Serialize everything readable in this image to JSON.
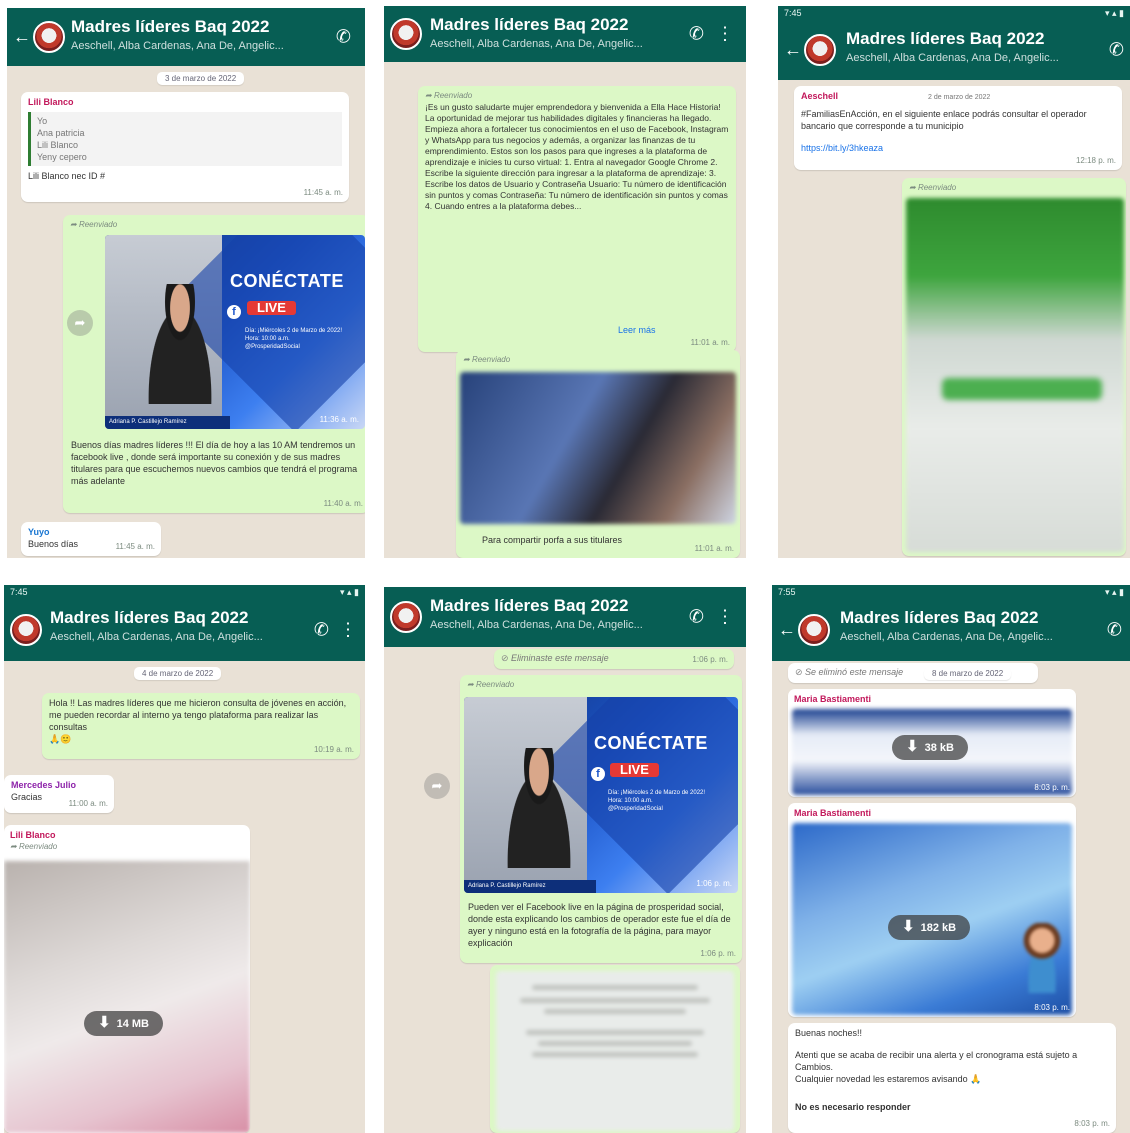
{
  "chat": {
    "title": "Madres líderes Baq 2022",
    "subtitle": "Aeschell, Alba Cardenas, Ana De, Angelic..."
  },
  "status": {
    "time": "7:45",
    "time2": "7:55"
  },
  "forwarded_label": "Reenviado",
  "p1": {
    "date": "3 de marzo de 2022",
    "reply_sender": "Lili Blanco",
    "reply_lines": [
      "Yo",
      "Ana patricia",
      "Lili Blanco",
      "Yeny cepero"
    ],
    "reply_text": "Lili Blanco nec ID #",
    "reply_time": "11:45 a. m.",
    "poster": {
      "headline": "CONÉCTATE",
      "live": "LIVE",
      "info_lines": [
        "Día: ¡Miércoles 2 de Marzo de 2022!",
        "Hora: 10:00 a.m."
      ],
      "handle": "@ProsperidadSocial",
      "caption": "Adriana P. Castillejo Ramírez",
      "time": "11:36 a. m."
    },
    "post_text": "Buenos días madres líderes !!! El día de hoy a las 10 AM tendremos un facebook live , donde será importante su conexión y de sus madres titulares para que escuchemos nuevos cambios que tendrá el programa más adelante",
    "post_time": "11:40 a. m.",
    "last_sender": "Yuyo",
    "last_text": "Buenos días",
    "last_time": "11:45 a. m."
  },
  "p2": {
    "msg_text": "¡Es un gusto saludarte mujer emprendedora y bienvenida a Ella Hace Historia! La oportunidad de mejorar tus habilidades digitales y financieras ha llegado. Empieza ahora a fortalecer tus conocimientos en el uso de Facebook, Instagram y WhatsApp para tus negocios y además, a organizar las finanzas de tu emprendimiento. Estos son los pasos para que ingreses a la plataforma de aprendizaje e inicies tu curso virtual: 1. Entra al navegador Google Chrome 2. Escribe la siguiente dirección para ingresar a la plataforma de aprendizaje: 3. Escribe los datos de Usuario y Contraseña Usuario: Tu número de identificación sin puntos y comas Contraseña: Tu número de identificación sin puntos y comas 4. Cuando entres a la plataforma debes...",
    "read_more": "Leer más",
    "msg_time": "11:01 a. m.",
    "caption": "Para compartir porfa a sus titulares",
    "caption_time": "11:01 a. m."
  },
  "p3": {
    "sender": "Aeschell",
    "date": "2 de marzo de 2022",
    "text": "#FamiliasEnAcción, en el siguiente enlace podrás consultar el operador bancario que corresponde a tu municipio",
    "link": "https://bit.ly/3hkeaza",
    "time": "12:18 p. m."
  },
  "p4": {
    "date": "4 de marzo de 2022",
    "out_text": "Hola !! Las madres líderes que me hicieron consulta de jóvenes en acción, me pueden recordar al interno ya tengo plataforma para realizar las consultas",
    "out_emoji": "🙏🙂",
    "out_time": "10:19 a. m.",
    "in_sender": "Mercedes Julio",
    "in_text": "Gracias",
    "in_time": "11:00 a. m.",
    "video_sender": "Lili Blanco",
    "video_size": "14 MB"
  },
  "p5": {
    "deleted": "Eliminaste este mensaje",
    "deleted_time": "1:06 p. m.",
    "poster": {
      "headline": "CONÉCTATE",
      "live": "LIVE",
      "info_lines": [
        "Día: ¡Miércoles 2 de Marzo de 2022!",
        "Hora: 10:00 a.m."
      ],
      "handle": "@ProsperidadSocial",
      "caption": "Adriana P. Castillejo Ramírez",
      "time": "1:06 p. m."
    },
    "text": "Pueden ver el Facebook live en la página de prosperidad social, donde esta explicando los cambios de operador este fue el día de ayer y ninguno está en la fotografía de la página, para mayor explicación",
    "time": "1:06 p. m."
  },
  "p6": {
    "deleted": "Se eliminó este mensaje",
    "date": "8 de marzo de 2022",
    "sender1": "Maria Bastiamenti",
    "size1": "38 kB",
    "time1": "8:03 p. m.",
    "sender2": "Maria Bastiamenti",
    "size2": "182 kB",
    "time2": "8:03 p. m.",
    "text_title": "Buenas noches!!",
    "text_body": "Atenti que se acaba de recibir una alerta y el cronograma está sujeto a Cambios.",
    "text_body2": "Cualquier novedad les estaremos avisando 🙏",
    "text_bold": "No es necesario responder",
    "text_time": "8:03 p. m."
  }
}
